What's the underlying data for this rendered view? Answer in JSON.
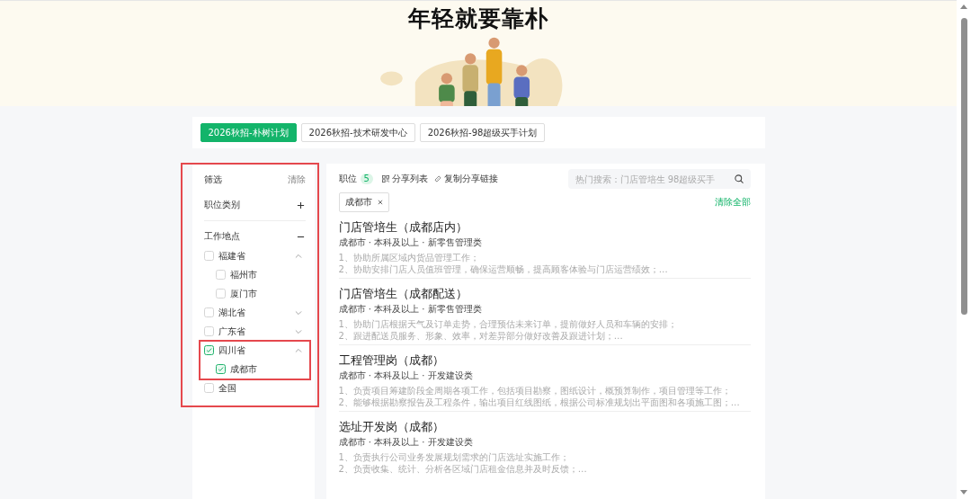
{
  "banner": {
    "title": "年轻就要靠朴"
  },
  "tabs": [
    {
      "label": "2026秋招-朴树计划",
      "selected": true
    },
    {
      "label": "2026秋招-技术研发中心",
      "selected": false
    },
    {
      "label": "2026秋招-98超级买手计划",
      "selected": false
    }
  ],
  "filter": {
    "title": "筛选",
    "clear": "清除",
    "highlighted": true,
    "sections": [
      {
        "label": "职位类别",
        "expanded": false
      },
      {
        "label": "工作地点",
        "expanded": true,
        "items": [
          {
            "label": "福建省",
            "checked": false,
            "expanded": true,
            "highlighted": false,
            "children": [
              {
                "label": "福州市",
                "checked": false
              },
              {
                "label": "厦门市",
                "checked": false
              }
            ]
          },
          {
            "label": "湖北省",
            "checked": false,
            "expanded": false,
            "highlighted": false
          },
          {
            "label": "广东省",
            "checked": false,
            "expanded": false,
            "highlighted": false
          },
          {
            "label": "四川省",
            "checked": true,
            "expanded": true,
            "highlighted": true,
            "children": [
              {
                "label": "成都市",
                "checked": true
              }
            ]
          },
          {
            "label": "全国",
            "checked": false,
            "highlighted": false
          }
        ]
      }
    ]
  },
  "positions": {
    "label": "职位",
    "count": "5",
    "share_list": "分享列表",
    "copy_link": "复制分享链接",
    "search": {
      "placeholder": "热门搜索：门店管培生 98超级买手"
    },
    "active_filters": [
      {
        "label": "成都市"
      }
    ],
    "clear_all": "清除全部",
    "jobs": [
      {
        "title": "门店管培生（成都店内）",
        "meta": "成都市 · 本科及以上 · 新零售管理类",
        "description": [
          "1、协助所属区域内货品管理工作；",
          "2、协助安排门店人员值班管理，确保运营顺畅，提高顾客体验与门店运营绩效；…"
        ]
      },
      {
        "title": "门店管培生（成都配送）",
        "meta": "成都市 · 本科及以上 · 新零售管理类",
        "description": [
          "1、协助门店根据天气及订单走势，合理预估未来订单，提前做好人员和车辆的安排；",
          "2、跟进配送员服务、形象、效率，对差异部分做好改善及跟进计划；…"
        ]
      },
      {
        "title": "工程管理岗（成都）",
        "meta": "成都市 · 本科及以上 · 开发建设类",
        "description": [
          "1、负责项目筹建阶段全周期各项工作，包括项目勘察，图纸设计，概预算制作，项目管理等工作；",
          "2、能够根据勘察报告及工程条件，输出项目红线图纸，根据公司标准规划出平面图和各项施工图；…"
        ]
      },
      {
        "title": "选址开发岗（成都）",
        "meta": "成都市 · 本科及以上 · 开发建设类",
        "description": [
          "1、负责执行公司业务发展规划需求的门店选址实施工作；",
          "2、负责收集、统计、分析各区域门店租金信息并及时反馈；…"
        ]
      }
    ]
  }
}
